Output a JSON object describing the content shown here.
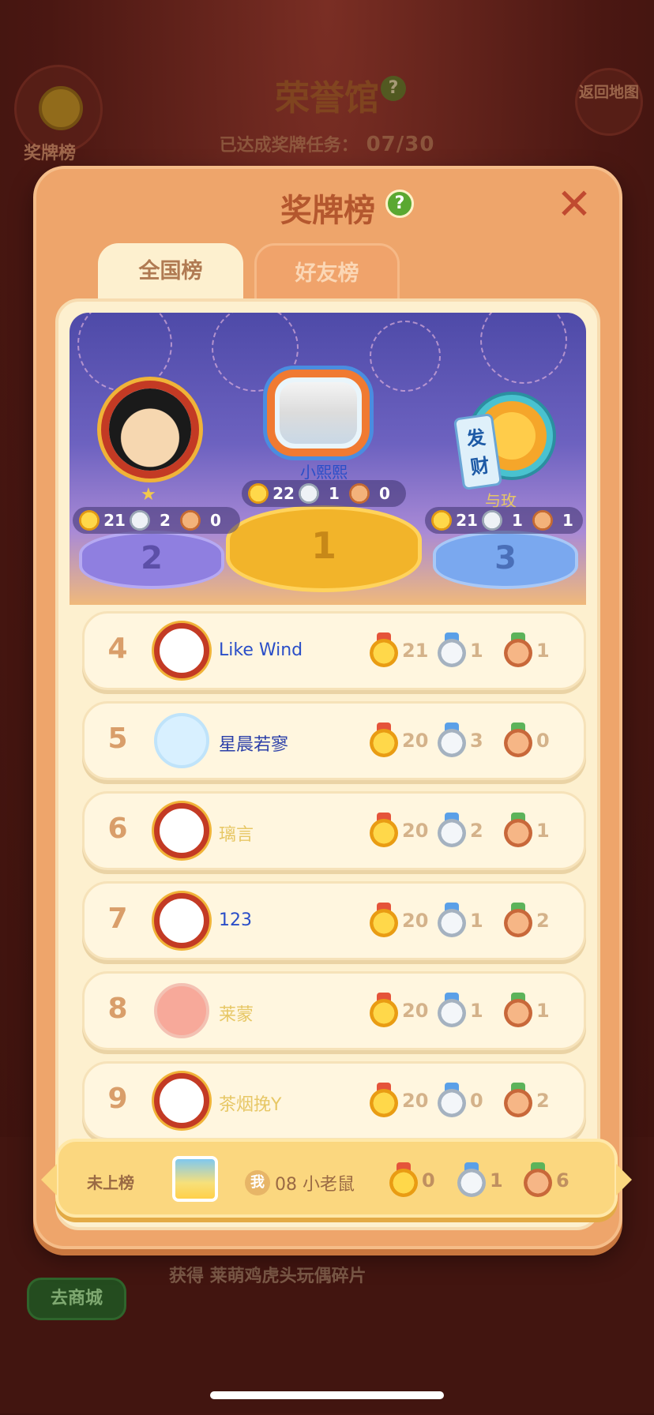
{
  "background": {
    "title": "荣誉馆",
    "help_icon": "?",
    "progress_label": "已达成奖牌任务：",
    "progress_value": "07/30",
    "left_button_label": "奖牌榜",
    "right_button_label": "返回地图",
    "shop_button_label": "去商城",
    "reward_text": "获得 莱萌鸡虎头玩偶碎片"
  },
  "panel": {
    "title": "奖牌榜",
    "help_icon": "?",
    "close_icon": "✕"
  },
  "tabs": [
    {
      "label": "全国榜",
      "active": true
    },
    {
      "label": "好友榜",
      "active": false
    }
  ],
  "podium": {
    "first": {
      "rank": "1",
      "name": "小熙熙",
      "gold": "22",
      "silver": "1",
      "bronze": "0"
    },
    "second": {
      "rank": "2",
      "name": "",
      "gold": "21",
      "silver": "2",
      "bronze": "0"
    },
    "third": {
      "rank": "3",
      "name": "与玫",
      "gold": "21",
      "silver": "1",
      "bronze": "1",
      "tag": "发财"
    }
  },
  "rankings": [
    {
      "rank": "4",
      "name": "Like  Wind",
      "gold": "21",
      "silver": "1",
      "bronze": "1"
    },
    {
      "rank": "5",
      "name": "星晨若寥",
      "gold": "20",
      "silver": "3",
      "bronze": "0"
    },
    {
      "rank": "6",
      "name": "璃言",
      "gold": "20",
      "silver": "2",
      "bronze": "1"
    },
    {
      "rank": "7",
      "name": "123",
      "gold": "20",
      "silver": "1",
      "bronze": "2"
    },
    {
      "rank": "8",
      "name": "莱蒙",
      "gold": "20",
      "silver": "1",
      "bronze": "1"
    },
    {
      "rank": "9",
      "name": "茶烟挽Y",
      "gold": "20",
      "silver": "0",
      "bronze": "2"
    }
  ],
  "my_rank": {
    "status": "未上榜",
    "me_badge": "我",
    "name": "08 小老鼠",
    "gold": "0",
    "silver": "1",
    "bronze": "6"
  },
  "colors": {
    "panel_bg": "#eea56b",
    "card_bg": "#fff6df",
    "rank_number": "#d99e6a",
    "name_blue": "#2a4ec8",
    "name_gold": "#e7c765"
  }
}
